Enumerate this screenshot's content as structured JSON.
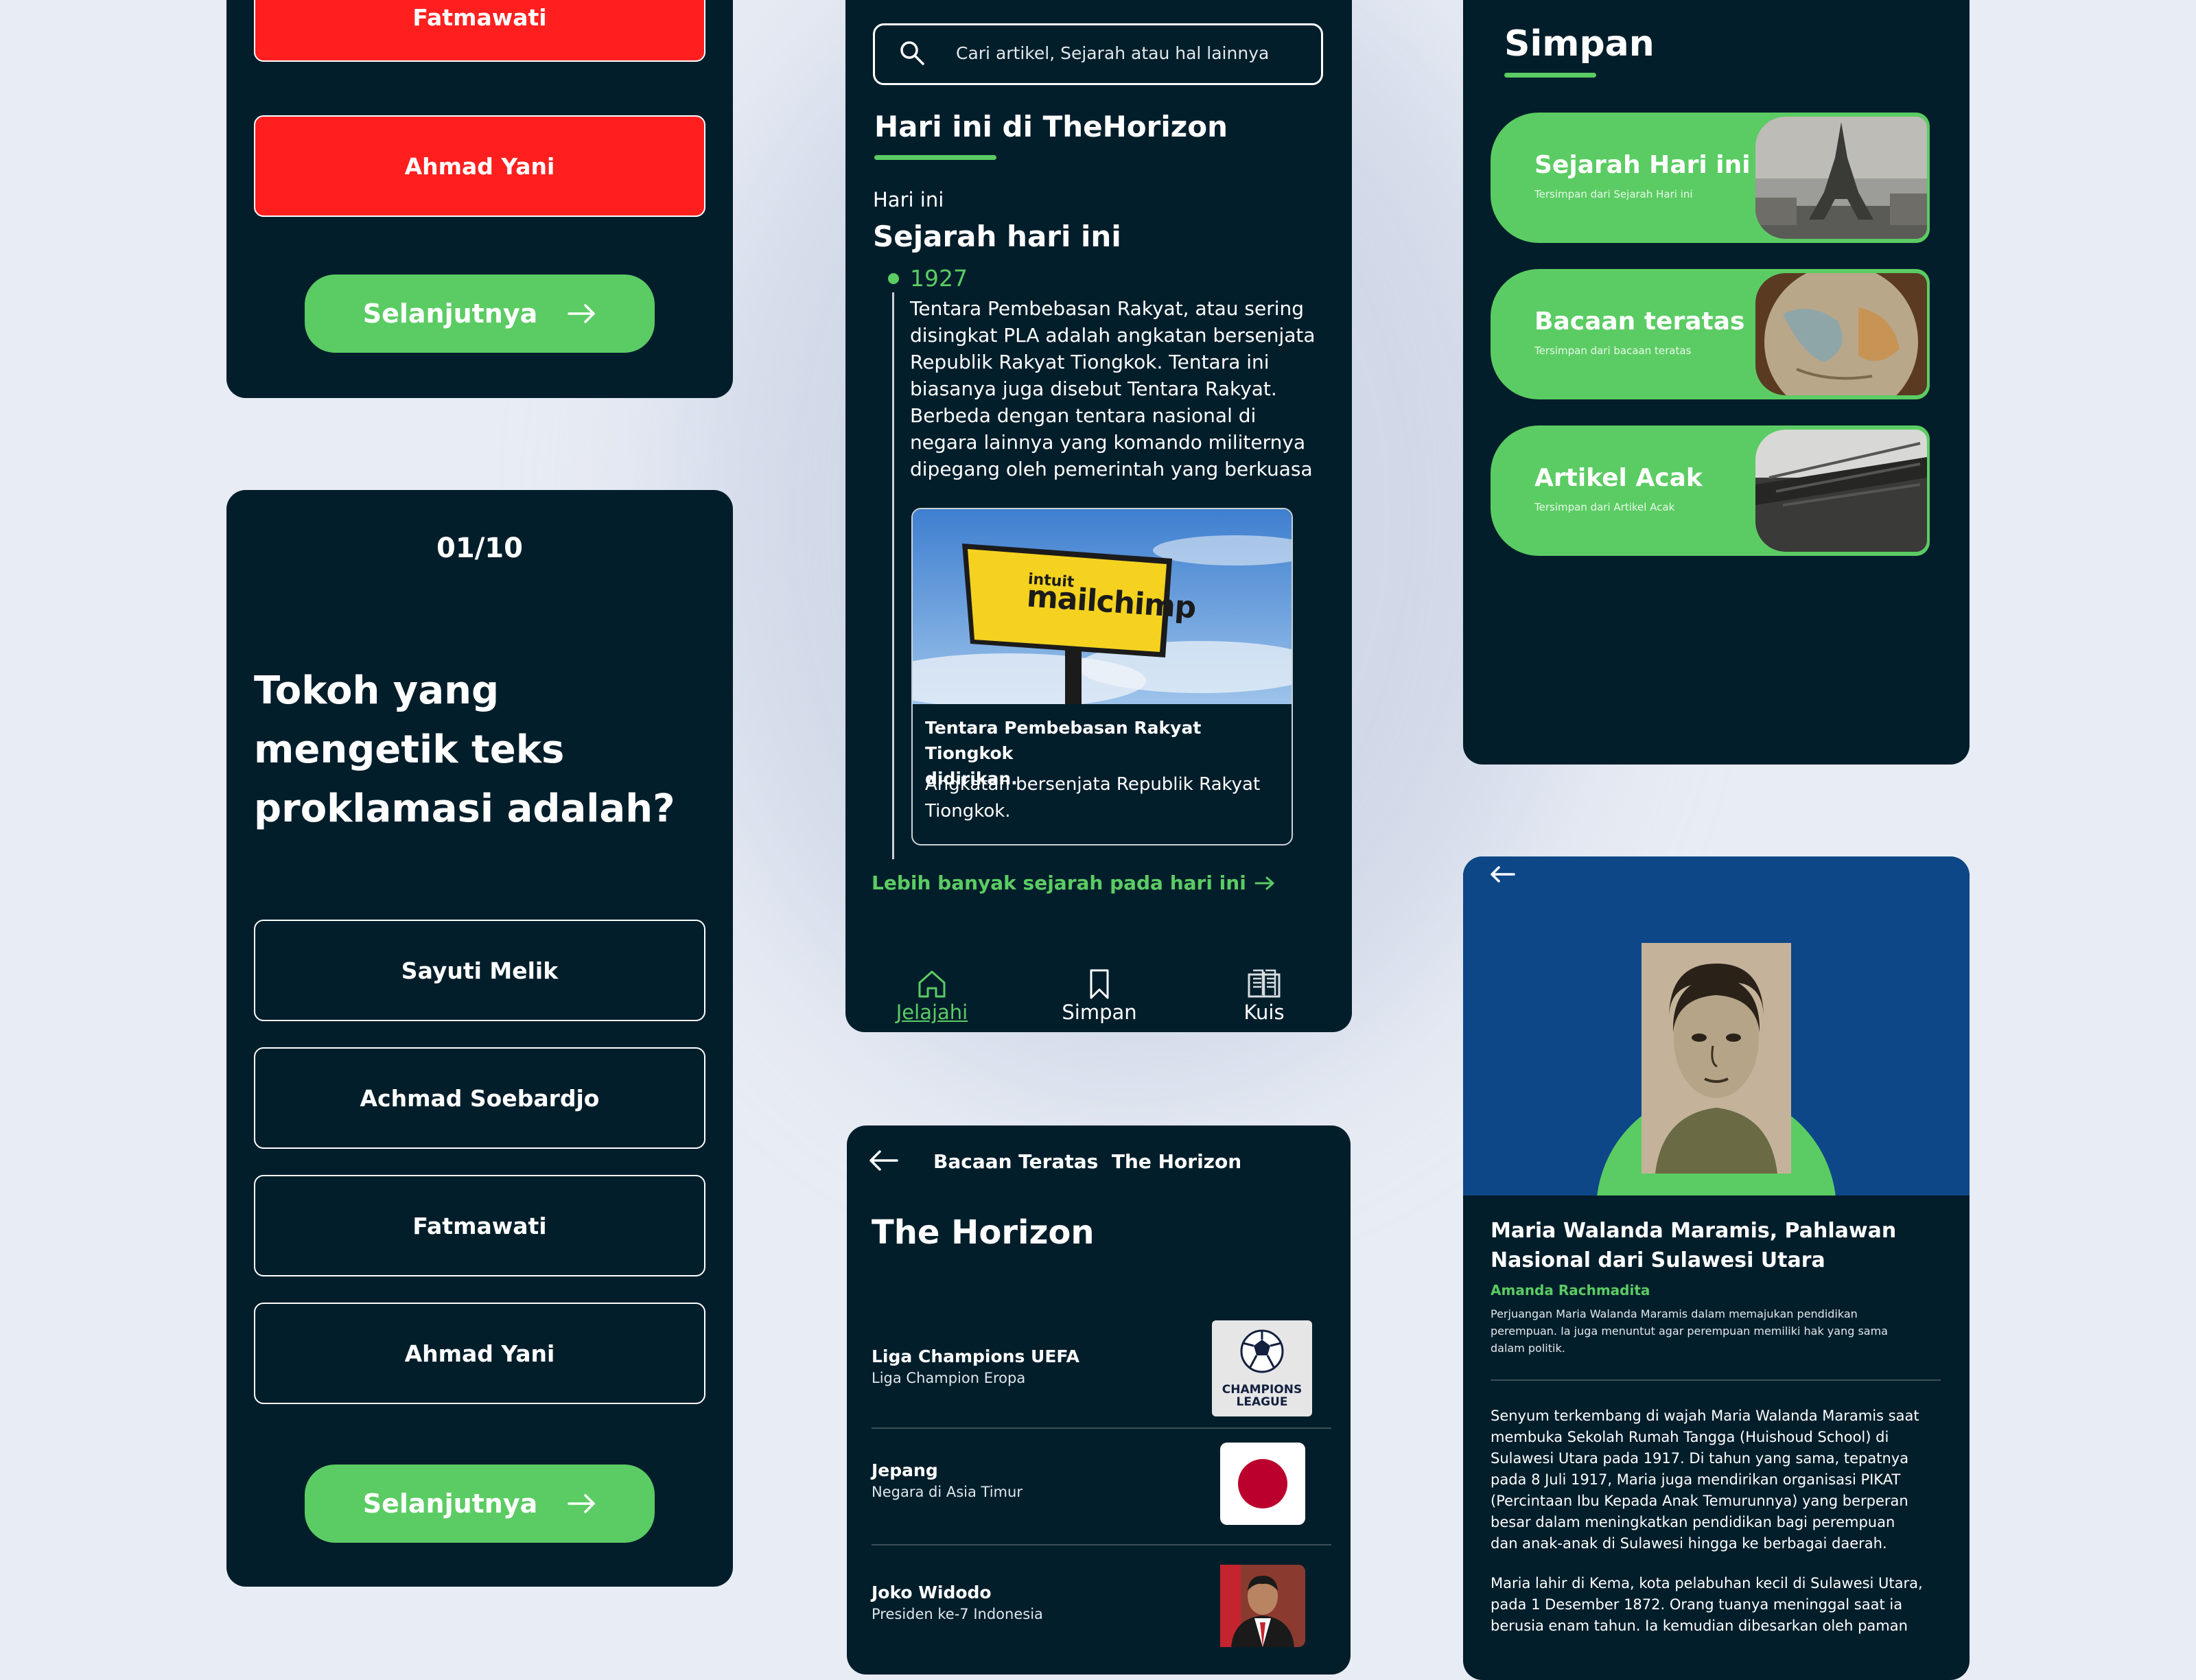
{
  "quiz_top": {
    "answers": [
      "Fatmawati",
      "Ahmad Yani"
    ],
    "next_label": "Selanjutnya"
  },
  "quiz": {
    "counter": "01/10",
    "question_lines": [
      "Tokoh yang",
      "mengetik teks",
      "proklamasi adalah?"
    ],
    "options": [
      "Sayuti Melik",
      "Achmad Soebardjo",
      "Fatmawati",
      "Ahmad Yani"
    ],
    "next_label": "Selanjutnya"
  },
  "explore": {
    "search_placeholder": "Cari artikel, Sejarah atau hal lainnya",
    "section_title": "Hari ini di TheHorizon",
    "today_label": "Hari ini",
    "today_title": "Sejarah hari ini",
    "event_year": "1927",
    "event_lines": [
      "Tentara Pembebasan Rakyat, atau sering",
      "disingkat PLA adalah angkatan bersenjata",
      "Republik Rakyat Tiongkok. Tentara ini",
      "biasanya juga disebut Tentara Rakyat.",
      "Berbeda dengan tentara nasional di",
      "negara lainnya yang komando militernya",
      "dipegang oleh pemerintah yang berkuasa"
    ],
    "sign_brand_small": "intuit",
    "sign_brand": "mailchimp",
    "image_caption_lines": [
      "Tentara Pembebasan Rakyat Tiongkok",
      "didirikan."
    ],
    "image_desc_lines": [
      "Angkatan bersenjata Republik Rakyat",
      "Tiongkok."
    ],
    "more_link": "Lebih banyak sejarah pada hari ini",
    "nav": [
      "Jelajahi",
      "Simpan",
      "Kuis"
    ]
  },
  "saved": {
    "title": "Simpan",
    "cards": [
      {
        "title": "Sejarah Hari ini",
        "subtitle": "Tersimpan dari Sejarah Hari ini"
      },
      {
        "title": "Bacaan teratas",
        "subtitle": "Tersimpan dari bacaan teratas"
      },
      {
        "title": "Artikel Acak",
        "subtitle": "Tersimpan dari Artikel Acak"
      }
    ]
  },
  "top_list": {
    "header": "Bacaan Teratas  The Horizon",
    "title": "The Horizon",
    "cl_logo_lines": [
      "CHAMPIONS",
      "LEAGUE"
    ],
    "rows": [
      {
        "title": "Liga Champions UEFA",
        "subtitle": "Liga Champion Eropa"
      },
      {
        "title": "Jepang",
        "subtitle": "Negara di Asia Timur"
      },
      {
        "title": "Joko Widodo",
        "subtitle": "Presiden ke-7 Indonesia"
      }
    ]
  },
  "article": {
    "title_lines": [
      "Maria Walanda Maramis, Pahlawan",
      "Nasional dari Sulawesi Utara"
    ],
    "author": "Amanda Rachmadita",
    "summary_lines": [
      "Perjuangan Maria Walanda Maramis dalam memajukan pendidikan",
      "perempuan. Ia juga menuntut agar perempuan memiliki hak yang sama",
      "dalam politik."
    ],
    "para1_lines": [
      "Senyum terkembang di wajah Maria Walanda Maramis saat",
      "membuka Sekolah Rumah Tangga (Huishoud School) di",
      "Sulawesi Utara pada 1917. Di tahun yang sama, tepatnya",
      "pada 8 Juli 1917, Maria juga mendirikan organisasi PIKAT",
      "(Percintaan Ibu Kepada Anak Temurunnya) yang berperan",
      "besar dalam meningkatkan pendidikan bagi perempuan",
      "dan anak-anak di Sulawesi hingga ke berbagai daerah."
    ],
    "para2_lines": [
      "Maria lahir di Kema, kota pelabuhan kecil di Sulawesi Utara,",
      "pada 1 Desember 1872. Orang tuanya meninggal saat ia",
      "berusia enam tahun. Ia kemudian dibesarkan oleh paman"
    ]
  },
  "colors": {
    "background": "#e8ecf4",
    "card": "#031e2b",
    "accent_green": "#5bcc63",
    "wrong_red": "#ff1f1f",
    "article_header_blue": "#0e4787"
  },
  "icons": [
    "search-icon",
    "arrow-right-icon",
    "arrow-left-icon",
    "home-icon",
    "bookmark-icon",
    "book-icon"
  ]
}
